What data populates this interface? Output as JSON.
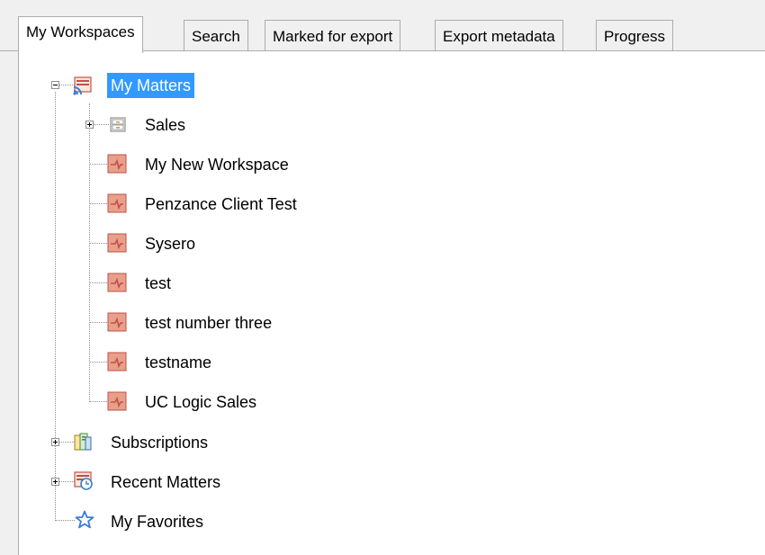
{
  "tabs": [
    {
      "label": "My Workspaces",
      "active": true
    },
    {
      "label": "Search",
      "active": false
    },
    {
      "label": "Marked for export",
      "active": false
    },
    {
      "label": "Export metadata",
      "active": false
    },
    {
      "label": "Progress",
      "active": false
    }
  ],
  "tree": {
    "root": {
      "label": "My Matters",
      "icon": "matters-feed-icon",
      "expanded": true,
      "selected": true
    },
    "children": [
      {
        "label": "Sales",
        "icon": "drawer-icon",
        "expandable": true,
        "expanded": false
      },
      {
        "label": "My New Workspace",
        "icon": "workspace-icon"
      },
      {
        "label": "Penzance Client Test",
        "icon": "workspace-icon"
      },
      {
        "label": "Sysero",
        "icon": "workspace-icon"
      },
      {
        "label": "test",
        "icon": "workspace-icon"
      },
      {
        "label": "test number three",
        "icon": "workspace-icon"
      },
      {
        "label": "testname",
        "icon": "workspace-icon"
      },
      {
        "label": "UC Logic Sales",
        "icon": "workspace-icon"
      }
    ],
    "siblings": [
      {
        "label": "Subscriptions",
        "icon": "subscriptions-icon",
        "expandable": true,
        "expanded": false
      },
      {
        "label": "Recent Matters",
        "icon": "recent-matters-icon",
        "expandable": true,
        "expanded": false
      },
      {
        "label": "My Favorites",
        "icon": "star-icon",
        "expandable": false
      }
    ]
  },
  "colors": {
    "selection": "#3399ff",
    "workspace_icon": "#c0504d",
    "star": "#3b7dd8"
  }
}
